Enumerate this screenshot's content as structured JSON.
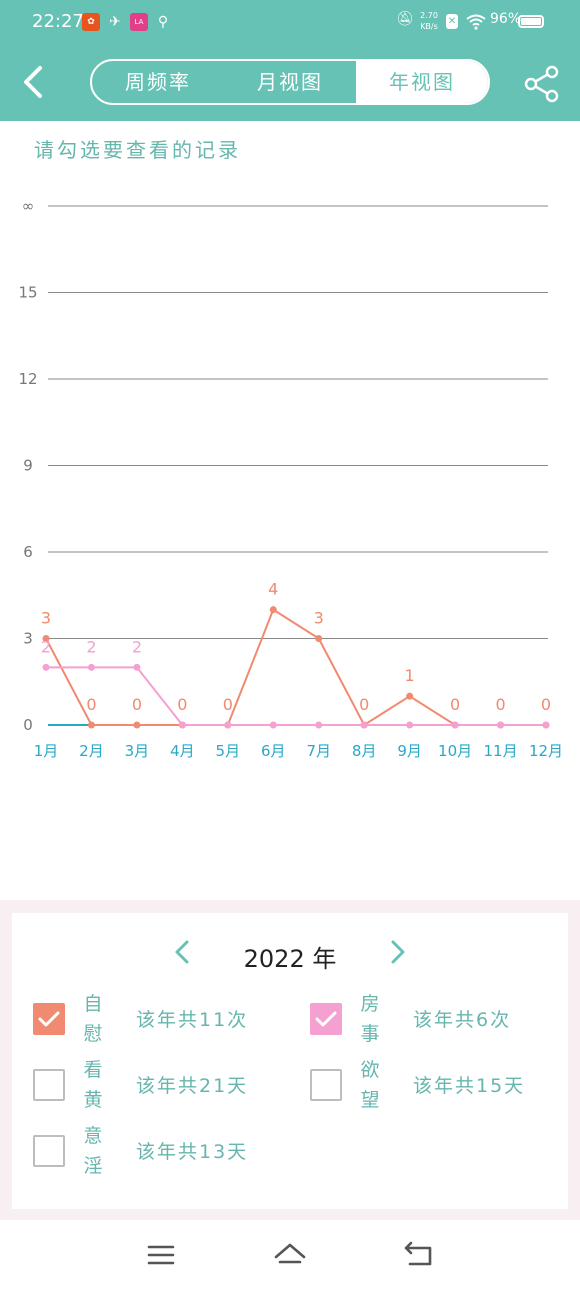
{
  "status_bar": {
    "time": "22:27",
    "net_speed_top": "2.70",
    "net_speed_unit": "KB/s",
    "battery": "96%",
    "icons": [
      "app-notification-icon",
      "dove-icon",
      "lala-icon",
      "location-icon",
      "mute-bell-icon",
      "sim-x-icon",
      "wifi-icon",
      "battery-icon"
    ]
  },
  "app_bar": {
    "tabs": [
      {
        "label": "周频率",
        "active": false
      },
      {
        "label": "月视图",
        "active": false
      },
      {
        "label": "年视图",
        "active": true
      }
    ]
  },
  "prompt": "请勾选要查看的记录",
  "colors": {
    "primary": "#66c2b4",
    "series_orange": "#f08a70",
    "series_pink": "#f4a0d0",
    "series_blue": "#2aa8c8",
    "axis_text": "#2aa8c8"
  },
  "chart_data": {
    "type": "line",
    "x": [
      "1月",
      "2月",
      "3月",
      "4月",
      "5月",
      "6月",
      "7月",
      "8月",
      "9月",
      "10月",
      "11月",
      "12月"
    ],
    "y_ticks": [
      "0",
      "3",
      "6",
      "9",
      "12",
      "15",
      "∞"
    ],
    "ylim": [
      0,
      18
    ],
    "grid": true,
    "series": [
      {
        "values": [
          3,
          0,
          0,
          0,
          0,
          4,
          3,
          0,
          1,
          0,
          0,
          0
        ],
        "color": "#f08a70"
      },
      {
        "values": [
          2,
          2,
          2,
          0,
          0,
          0,
          0,
          0,
          0,
          0,
          0,
          0
        ],
        "color": "#f4a0d0"
      }
    ],
    "value_labels": [
      "3",
      "0",
      "0",
      "0",
      "0",
      "4",
      "3",
      "0",
      "1",
      "0",
      "0",
      "0"
    ],
    "secondary_value_labels": [
      "2",
      "2",
      "2"
    ]
  },
  "panel": {
    "year": "2022 年",
    "records": [
      {
        "label": "自慰",
        "count": "该年共11次",
        "checked": true,
        "color": "#f08a70"
      },
      {
        "label": "房事",
        "count": "该年共6次",
        "checked": true,
        "color": "#f4a0d0"
      },
      {
        "label": "看黄",
        "count": "该年共21天",
        "checked": false,
        "color": "#bdbdbd"
      },
      {
        "label": "欲望",
        "count": "该年共15天",
        "checked": false,
        "color": "#bdbdbd"
      },
      {
        "label": "意淫",
        "count": "该年共13天",
        "checked": false,
        "color": "#bdbdbd"
      }
    ]
  }
}
